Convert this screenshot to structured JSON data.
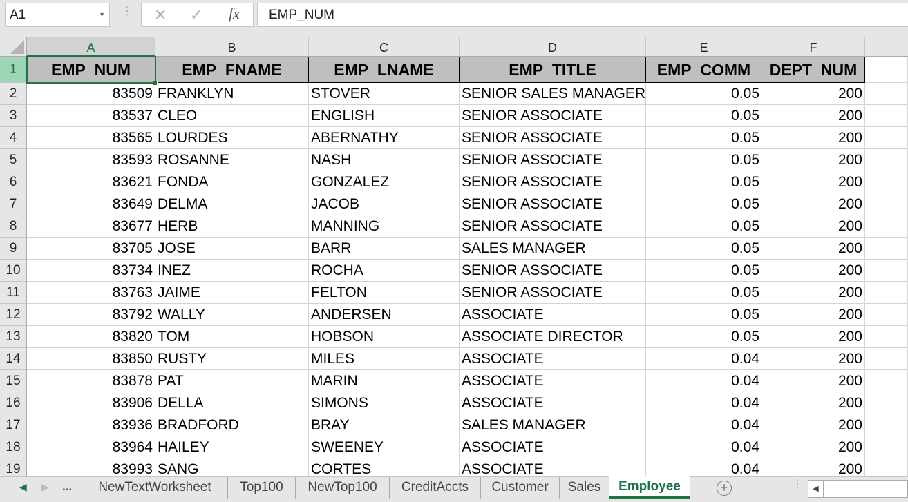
{
  "formula_bar": {
    "name_box": "A1",
    "cancel_icon": "✕",
    "enter_icon": "✓",
    "fx_label": "fx",
    "formula": "EMP_NUM"
  },
  "columns": [
    "A",
    "B",
    "C",
    "D",
    "E",
    "F"
  ],
  "header_row": [
    "EMP_NUM",
    "EMP_FNAME",
    "EMP_LNAME",
    "EMP_TITLE",
    "EMP_COMM",
    "DEPT_NUM"
  ],
  "rows": [
    {
      "n": "2",
      "cells": [
        "83509",
        "FRANKLYN",
        "STOVER",
        "SENIOR SALES MANAGER",
        "0.05",
        "200"
      ]
    },
    {
      "n": "3",
      "cells": [
        "83537",
        "CLEO",
        "ENGLISH",
        "SENIOR ASSOCIATE",
        "0.05",
        "200"
      ]
    },
    {
      "n": "4",
      "cells": [
        "83565",
        "LOURDES",
        "ABERNATHY",
        "SENIOR ASSOCIATE",
        "0.05",
        "200"
      ]
    },
    {
      "n": "5",
      "cells": [
        "83593",
        "ROSANNE",
        "NASH",
        "SENIOR ASSOCIATE",
        "0.05",
        "200"
      ]
    },
    {
      "n": "6",
      "cells": [
        "83621",
        "FONDA",
        "GONZALEZ",
        "SENIOR ASSOCIATE",
        "0.05",
        "200"
      ]
    },
    {
      "n": "7",
      "cells": [
        "83649",
        "DELMA",
        "JACOB",
        "SENIOR ASSOCIATE",
        "0.05",
        "200"
      ]
    },
    {
      "n": "8",
      "cells": [
        "83677",
        "HERB",
        "MANNING",
        "SENIOR ASSOCIATE",
        "0.05",
        "200"
      ]
    },
    {
      "n": "9",
      "cells": [
        "83705",
        "JOSE",
        "BARR",
        "SALES MANAGER",
        "0.05",
        "200"
      ]
    },
    {
      "n": "10",
      "cells": [
        "83734",
        "INEZ",
        "ROCHA",
        "SENIOR ASSOCIATE",
        "0.05",
        "200"
      ]
    },
    {
      "n": "11",
      "cells": [
        "83763",
        "JAIME",
        "FELTON",
        "SENIOR ASSOCIATE",
        "0.05",
        "200"
      ]
    },
    {
      "n": "12",
      "cells": [
        "83792",
        "WALLY",
        "ANDERSEN",
        "ASSOCIATE",
        "0.05",
        "200"
      ]
    },
    {
      "n": "13",
      "cells": [
        "83820",
        "TOM",
        "HOBSON",
        "ASSOCIATE DIRECTOR",
        "0.05",
        "200"
      ]
    },
    {
      "n": "14",
      "cells": [
        "83850",
        "RUSTY",
        "MILES",
        "ASSOCIATE",
        "0.04",
        "200"
      ]
    },
    {
      "n": "15",
      "cells": [
        "83878",
        "PAT",
        "MARIN",
        "ASSOCIATE",
        "0.04",
        "200"
      ]
    },
    {
      "n": "16",
      "cells": [
        "83906",
        "DELLA",
        "SIMONS",
        "ASSOCIATE",
        "0.04",
        "200"
      ]
    },
    {
      "n": "17",
      "cells": [
        "83936",
        "BRADFORD",
        "BRAY",
        "SALES MANAGER",
        "0.04",
        "200"
      ]
    },
    {
      "n": "18",
      "cells": [
        "83964",
        "HAILEY",
        "SWEENEY",
        "ASSOCIATE",
        "0.04",
        "200"
      ]
    },
    {
      "n": "19",
      "cells": [
        "83993",
        "SANG",
        "CORTES",
        "ASSOCIATE",
        "0.04",
        "200"
      ]
    }
  ],
  "sheet_tabs": {
    "more": "...",
    "tabs": [
      "NewTextWorksheet",
      "Top100",
      "NewTop100",
      "CreditAccts",
      "Customer",
      "Sales",
      "Employee"
    ],
    "active": "Employee",
    "add_icon": "+"
  },
  "colors": {
    "accent": "#217346",
    "header_fill": "#bfbfbf"
  }
}
